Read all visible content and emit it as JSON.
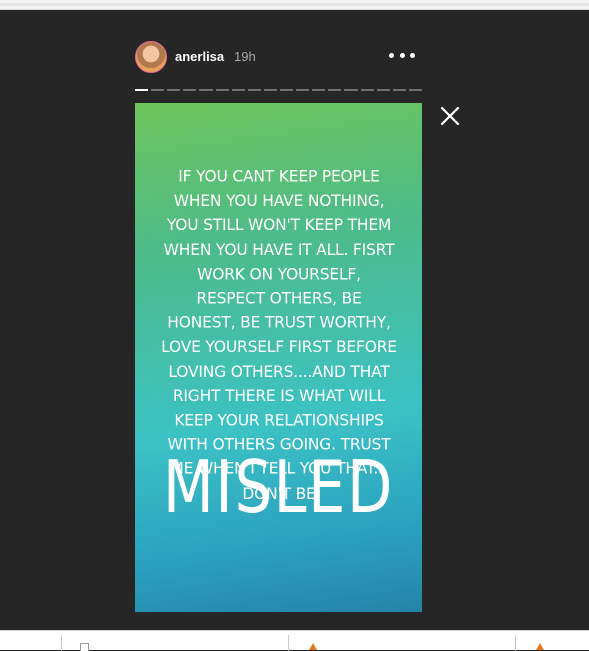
{
  "story": {
    "username": "anerlisa",
    "time": "19h",
    "more_icon": "ellipsis-icon",
    "close_icon": "close-icon",
    "segments_total": 18,
    "active_segment": 1,
    "quote": "If you cant keep people when you have nothing, you still won't keep them when you have it all. Fisrt work on yourself, respect others, be honest, be trust worthy, love yourself first before loving others....and that right there is what will keep your relationships with others going. Trust me when I tell you that... don't be",
    "big_word": "MISLED",
    "background_colors": [
      "#6ec55b",
      "#3cc2c4",
      "#2583a8"
    ]
  },
  "colors": {
    "viewer_bg": "#262626",
    "text": "#ffffff",
    "time_text": "#a8a8a8"
  }
}
